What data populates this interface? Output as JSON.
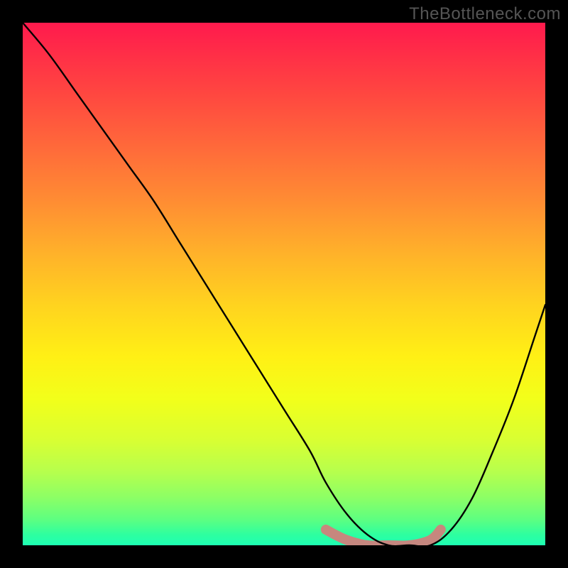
{
  "watermark": "TheBottleneck.com",
  "colors": {
    "page_bg": "#000000",
    "curve": "#000000",
    "optimal_band": "#d77a7a",
    "gradient_top": "#ff1a4d",
    "gradient_mid": "#ffd31f",
    "gradient_bottom": "#1effb3"
  },
  "chart_data": {
    "type": "line",
    "title": "",
    "xlabel": "",
    "ylabel": "",
    "xlim": [
      0,
      100
    ],
    "ylim": [
      0,
      100
    ],
    "axis_ticks_visible": false,
    "legend_visible": false,
    "grid": false,
    "annotations": [
      {
        "text": "TheBottleneck.com",
        "position": "top-right"
      }
    ],
    "series": [
      {
        "name": "bottleneck-curve",
        "x": [
          0,
          5,
          10,
          15,
          20,
          25,
          30,
          35,
          40,
          45,
          50,
          55,
          58,
          62,
          66,
          70,
          74,
          78,
          82,
          86,
          90,
          94,
          98,
          100
        ],
        "values": [
          100,
          94,
          87,
          80,
          73,
          66,
          58,
          50,
          42,
          34,
          26,
          18,
          12,
          6,
          2,
          0,
          0,
          0,
          3,
          9,
          18,
          28,
          40,
          46
        ]
      },
      {
        "name": "optimal-band",
        "x": [
          58,
          62,
          66,
          70,
          74,
          78,
          80
        ],
        "values": [
          3,
          1,
          0,
          0,
          0,
          1,
          3
        ]
      }
    ],
    "note": "Values estimated from gradient position and curve trajectory; y=0 is bottom (green / no bottleneck), y=100 is top (red / heavy bottleneck)."
  }
}
